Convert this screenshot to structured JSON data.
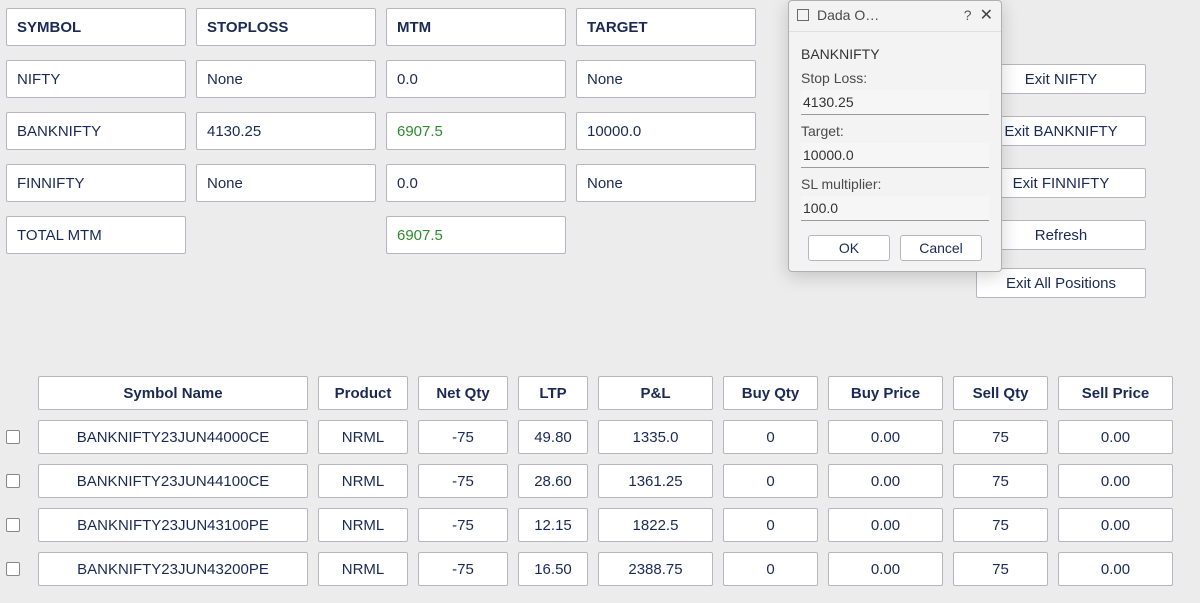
{
  "headers": {
    "symbol": "SYMBOL",
    "stoploss": "STOPLOSS",
    "mtm": "MTM",
    "target": "TARGET"
  },
  "rows": [
    {
      "symbol": "NIFTY",
      "stoploss": "None",
      "mtm": "0.0",
      "mtm_positive": false,
      "target": "None",
      "exit": "Exit NIFTY"
    },
    {
      "symbol": "BANKNIFTY",
      "stoploss": "4130.25",
      "mtm": "6907.5",
      "mtm_positive": true,
      "target": "10000.0",
      "exit": "Exit BANKNIFTY"
    },
    {
      "symbol": "FINNIFTY",
      "stoploss": "None",
      "mtm": "0.0",
      "mtm_positive": false,
      "target": "None",
      "exit": "Exit FINNIFTY"
    }
  ],
  "total_row": {
    "label": "TOTAL MTM",
    "mtm": "6907.5",
    "refresh": "Refresh"
  },
  "exit_all": "Exit All Positions",
  "positions_headers": {
    "symbol_name": "Symbol Name",
    "product": "Product",
    "net_qty": "Net Qty",
    "ltp": "LTP",
    "pnl": "P&L",
    "buy_qty": "Buy Qty",
    "buy_price": "Buy Price",
    "sell_qty": "Sell Qty",
    "sell_price": "Sell Price"
  },
  "positions": [
    {
      "symbol_name": "BANKNIFTY23JUN44000CE",
      "product": "NRML",
      "net_qty": "-75",
      "ltp": "49.80",
      "pnl": "1335.0",
      "buy_qty": "0",
      "buy_price": "0.00",
      "sell_qty": "75",
      "sell_price": "0.00"
    },
    {
      "symbol_name": "BANKNIFTY23JUN44100CE",
      "product": "NRML",
      "net_qty": "-75",
      "ltp": "28.60",
      "pnl": "1361.25",
      "buy_qty": "0",
      "buy_price": "0.00",
      "sell_qty": "75",
      "sell_price": "0.00"
    },
    {
      "symbol_name": "BANKNIFTY23JUN43100PE",
      "product": "NRML",
      "net_qty": "-75",
      "ltp": "12.15",
      "pnl": "1822.5",
      "buy_qty": "0",
      "buy_price": "0.00",
      "sell_qty": "75",
      "sell_price": "0.00"
    },
    {
      "symbol_name": "BANKNIFTY23JUN43200PE",
      "product": "NRML",
      "net_qty": "-75",
      "ltp": "16.50",
      "pnl": "2388.75",
      "buy_qty": "0",
      "buy_price": "0.00",
      "sell_qty": "75",
      "sell_price": "0.00"
    }
  ],
  "dialog": {
    "title": "Dada O…",
    "help": "?",
    "symbol": "BANKNIFTY",
    "label_stoploss": "Stop Loss:",
    "value_stoploss": "4130.25",
    "label_target": "Target:",
    "value_target": "10000.0",
    "label_slmult": "SL multiplier:",
    "value_slmult": "100.0",
    "ok": "OK",
    "cancel": "Cancel"
  }
}
